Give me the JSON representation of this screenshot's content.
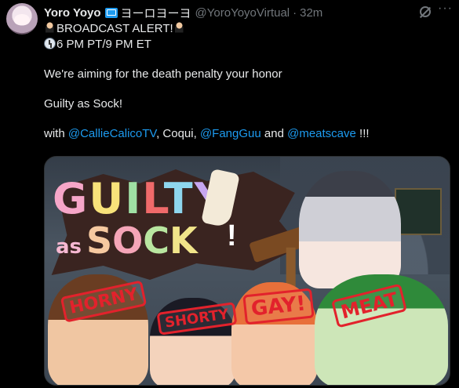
{
  "tweet": {
    "display_name": "Yoro Yoyo",
    "name_katakana": "ヨーロヨーヨ",
    "handle": "@YoroYoyoVirtual",
    "separator": "·",
    "timestamp": "32m",
    "more": "···",
    "lines": {
      "alert": "BROADCAST ALERT!",
      "time": "6 PM PT/9 PM ET",
      "aim": "We're aiming for the death penalty your honor",
      "title": "Guilty as Sock!",
      "with_prefix": "with ",
      "mention1": "@CallieCalicoTV",
      "mid1": ", Coqui, ",
      "mention2": "@FangGuu",
      "mid2": " and ",
      "mention3": "@meatscave",
      "suffix": " !!!"
    },
    "icons": [
      "judge-emoji",
      "clock-emoji",
      "tv-badge",
      "grok-icon",
      "more-icon"
    ],
    "colors": {
      "link": "#1d9bf0",
      "secondary": "#71767b",
      "text": "#e7e9ea",
      "background": "#000000"
    }
  },
  "media": {
    "logo_line1": [
      "G",
      "U",
      "I",
      "L",
      "T",
      "Y"
    ],
    "logo_as": "as",
    "logo_line2": [
      "S",
      "O",
      "C",
      "K"
    ],
    "logo_bang": "!",
    "stamps": {
      "horny": "HORNY",
      "shorty": "SHORTY",
      "gay": "GAY!",
      "meat": "MEAT"
    }
  }
}
